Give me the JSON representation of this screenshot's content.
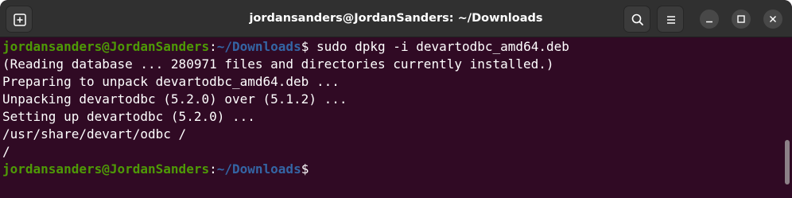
{
  "window": {
    "title": "jordansanders@JordanSanders: ~/Downloads"
  },
  "header_icons": {
    "new_tab": "new-tab-icon",
    "search": "search-icon",
    "menu": "hamburger-menu-icon",
    "minimize": "minimize-icon",
    "maximize": "maximize-icon",
    "close": "close-icon"
  },
  "colors": {
    "terminal_bg": "#300a24",
    "titlebar_bg": "#303030",
    "prompt_user": "#4e9a06",
    "prompt_path": "#3465a4",
    "text": "#ffffff"
  },
  "terminal": {
    "prompt1": {
      "user_host": "jordansanders@JordanSanders",
      "colon": ":",
      "path": "~/Downloads",
      "symbol": "$",
      "command": " sudo dpkg -i devartodbc_amd64.deb"
    },
    "output": [
      "(Reading database ... 280971 files and directories currently installed.)",
      "Preparing to unpack devartodbc_amd64.deb ...",
      "Unpacking devartodbc (5.2.0) over (5.1.2) ...",
      "Setting up devartodbc (5.2.0) ...",
      "/usr/share/devart/odbc /",
      "/"
    ],
    "prompt2": {
      "user_host": "jordansanders@JordanSanders",
      "colon": ":",
      "path": "~/Downloads",
      "symbol": "$",
      "command": ""
    }
  }
}
